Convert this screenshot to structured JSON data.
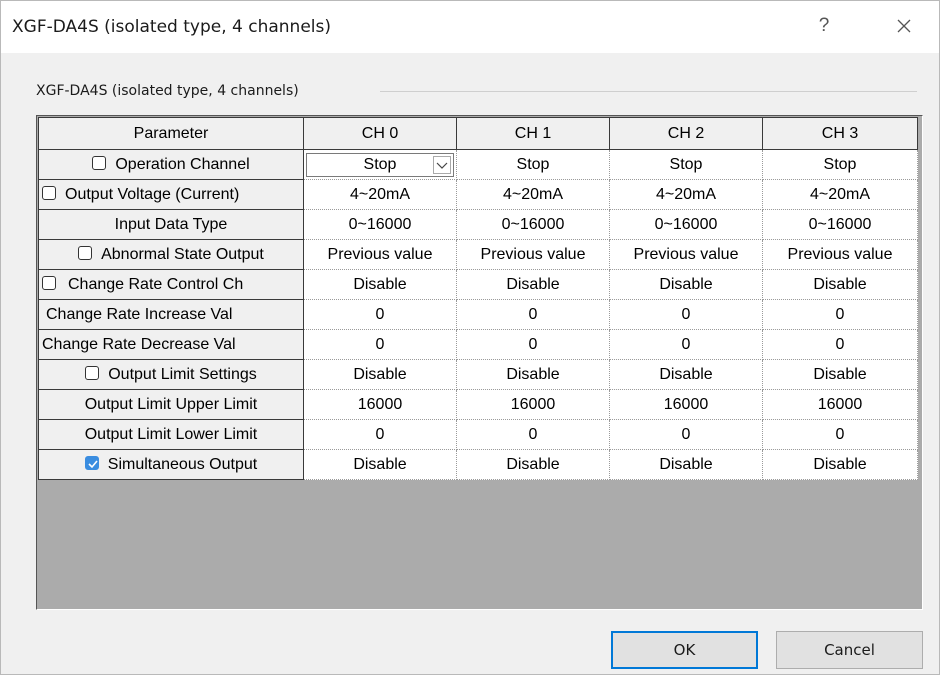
{
  "window": {
    "title": "XGF-DA4S (isolated type, 4 channels)",
    "help_label": "?"
  },
  "group": {
    "label": "XGF-DA4S (isolated type, 4 channels)"
  },
  "grid": {
    "headers": [
      "Parameter",
      "CH 0",
      "CH 1",
      "CH 2",
      "CH 3"
    ],
    "rows": [
      {
        "name": "Operation Channel",
        "checkbox": "unchecked",
        "values": [
          "Stop",
          "Stop",
          "Stop",
          "Stop"
        ]
      },
      {
        "name": "Output Voltage (Current)",
        "checkbox": "unchecked",
        "values": [
          "4~20mA",
          "4~20mA",
          "4~20mA",
          "4~20mA"
        ]
      },
      {
        "name": "Input Data Type",
        "checkbox": "none",
        "values": [
          "0~16000",
          "0~16000",
          "0~16000",
          "0~16000"
        ]
      },
      {
        "name": "Abnormal State Output",
        "checkbox": "unchecked",
        "values": [
          "Previous value",
          "Previous value",
          "Previous value",
          "Previous value"
        ]
      },
      {
        "name": "Change Rate Control Ch",
        "checkbox": "unchecked",
        "values": [
          "Disable",
          "Disable",
          "Disable",
          "Disable"
        ]
      },
      {
        "name": "Change Rate Increase Val",
        "checkbox": "none",
        "values": [
          "0",
          "0",
          "0",
          "0"
        ]
      },
      {
        "name": "Change Rate Decrease Val",
        "checkbox": "none",
        "values": [
          "0",
          "0",
          "0",
          "0"
        ]
      },
      {
        "name": "Output Limit Settings",
        "checkbox": "unchecked",
        "values": [
          "Disable",
          "Disable",
          "Disable",
          "Disable"
        ]
      },
      {
        "name": "Output Limit Upper Limit",
        "checkbox": "none",
        "values": [
          "16000",
          "16000",
          "16000",
          "16000"
        ]
      },
      {
        "name": "Output Limit Lower Limit",
        "checkbox": "none",
        "values": [
          "0",
          "0",
          "0",
          "0"
        ]
      },
      {
        "name": "Simultaneous Output",
        "checkbox": "checked",
        "values": [
          "Disable",
          "Disable",
          "Disable",
          "Disable"
        ]
      }
    ],
    "active_cell": {
      "row": 0,
      "column": 0,
      "control": "combobox"
    }
  },
  "buttons": {
    "ok": "OK",
    "cancel": "Cancel"
  },
  "colors": {
    "checked_accent": "#3a8de0",
    "default_button_border": "#0078d7"
  },
  "icons": {
    "close": "close-icon",
    "combo": "chevron-down-icon",
    "check": "checkmark-icon"
  }
}
